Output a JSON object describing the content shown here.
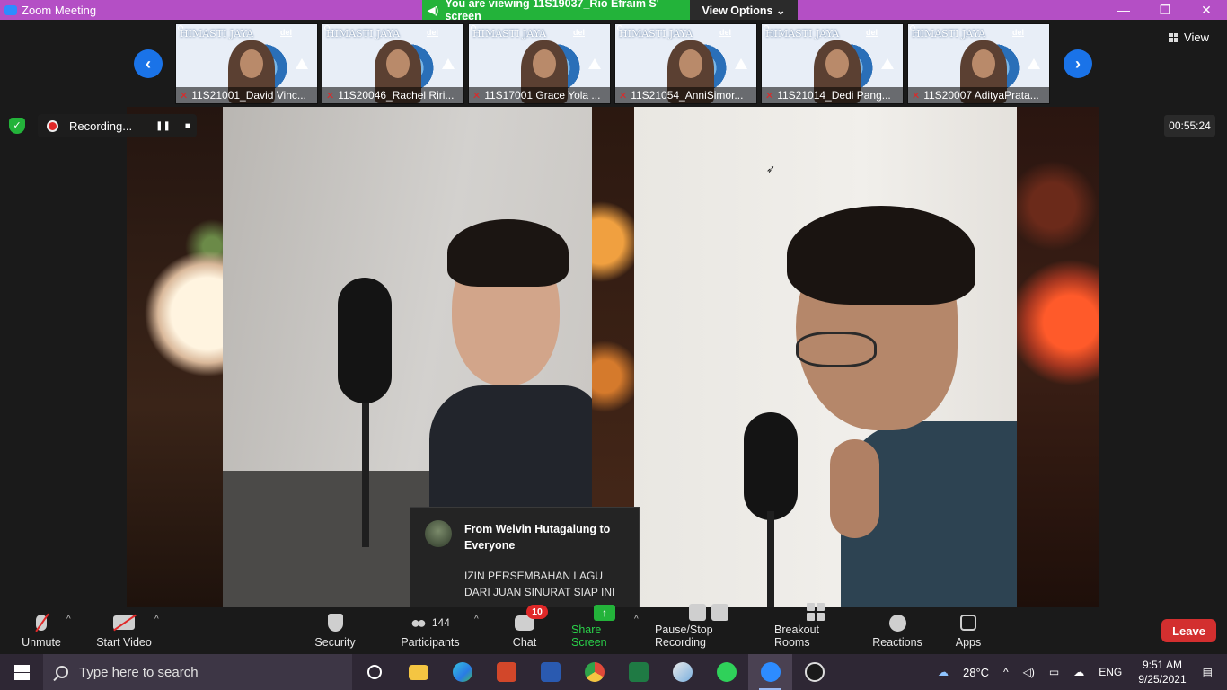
{
  "window": {
    "title": "Zoom Meeting",
    "controls": [
      "—",
      "❐",
      "✕"
    ],
    "accent": "#b44fc5"
  },
  "share_banner": {
    "text": "You are viewing 11S19037_Rio Efraim S' screen",
    "view_options": "View Options ⌄",
    "color": "#23b33a"
  },
  "view_button": {
    "label": "View"
  },
  "participants_strip": [
    {
      "brand": "HIMASTI JAYA",
      "tag": "del",
      "name": "11S21001_David Vinc..."
    },
    {
      "brand": "HIMASTI JAYA",
      "tag": "del",
      "name": "11S20046_Rachel Riri..."
    },
    {
      "brand": "HIMASTI JAYA",
      "tag": "del",
      "name": "11S17001 Grace Yola ..."
    },
    {
      "brand": "HIMASTI JAYA",
      "tag": "del",
      "name": "11S21054_AnniSimor..."
    },
    {
      "brand": "HIMASTI JAYA",
      "tag": "del",
      "name": "11S21014_Dedi Pang..."
    },
    {
      "brand": "HIMASTI JAYA",
      "tag": "del",
      "name": "11S20007 AdityaPrata..."
    }
  ],
  "recording": {
    "label": "Recording...",
    "pause": "❚❚",
    "stop": "■"
  },
  "timer": "00:55:24",
  "chat_popup": {
    "from": "From Welvin Hutagalung to Everyone",
    "message": "IZIN PERSEMBAHAN LAGU DARI JUAN SINURAT SIAP INI"
  },
  "toolbar": {
    "unmute": "Unmute",
    "start_video": "Start Video",
    "security": "Security",
    "participants": "Participants",
    "participants_count": "144",
    "chat": "Chat",
    "chat_badge": "10",
    "share_screen": "Share Screen",
    "pause_stop": "Pause/Stop Recording",
    "breakout": "Breakout Rooms",
    "reactions": "Reactions",
    "apps": "Apps",
    "leave": "Leave",
    "leave_color": "#d32f2f"
  },
  "taskbar": {
    "search_placeholder": "Type here to search",
    "apps": [
      "cortana-icon",
      "file-explorer-icon",
      "edge-icon",
      "powerpoint-icon",
      "word-icon",
      "chrome-icon",
      "excel-icon",
      "paint-icon",
      "whatsapp-icon",
      "zoom-icon",
      "obs-icon"
    ],
    "weather": "28°C",
    "language": "ENG",
    "time": "9:51 AM",
    "date": "9/25/2021"
  }
}
